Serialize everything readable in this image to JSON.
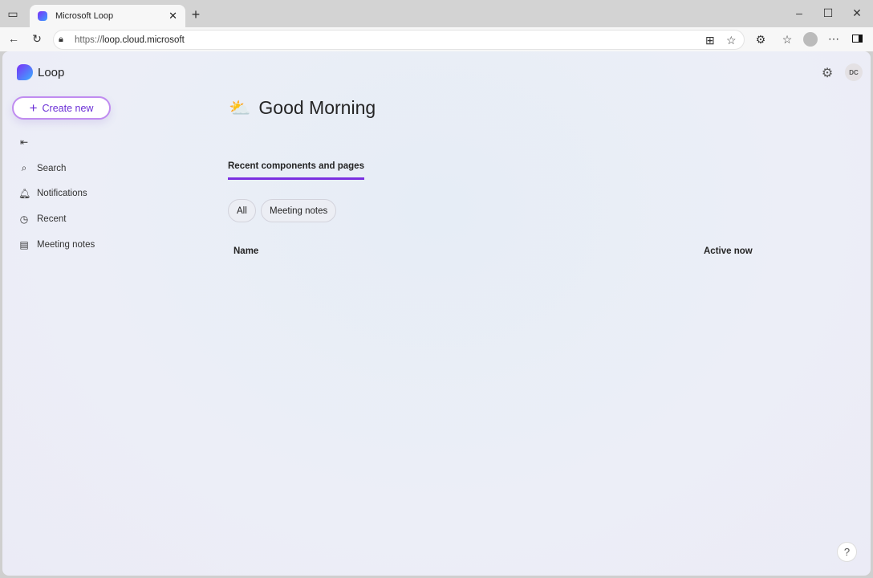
{
  "browser": {
    "tab_title": "Microsoft Loop",
    "url_prefix": "https://",
    "url_host": "loop.cloud.microsoft"
  },
  "app": {
    "name": "Loop",
    "create_label": "Create new",
    "avatar_initials": "DC",
    "help": "?",
    "nav": [
      {
        "label": "Search",
        "icon": "search-icon"
      },
      {
        "label": "Notifications",
        "icon": "bell-icon"
      },
      {
        "label": "Recent",
        "icon": "clock-icon"
      },
      {
        "label": "Meeting notes",
        "icon": "notes-icon"
      }
    ],
    "greeting": "Good Morning",
    "section_tab": "Recent components and pages",
    "filters": [
      "All",
      "Meeting notes"
    ],
    "columns": [
      "Name",
      "Active now"
    ]
  }
}
